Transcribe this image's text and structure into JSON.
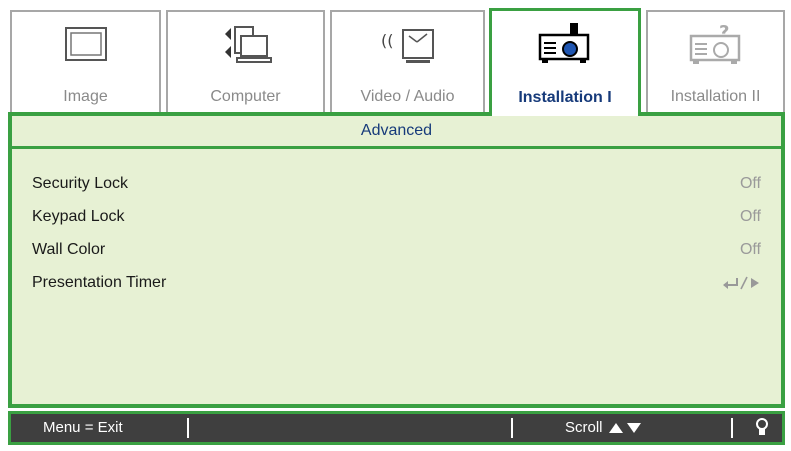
{
  "tabs": [
    {
      "label": "Image",
      "icon": "image-icon",
      "active": false
    },
    {
      "label": "Computer",
      "icon": "computer-icon",
      "active": false
    },
    {
      "label": "Video / Audio",
      "icon": "video-audio-icon",
      "active": false
    },
    {
      "label": "Installation I",
      "icon": "projector-icon",
      "active": true
    },
    {
      "label": "Installation II",
      "icon": "projector-question-icon",
      "active": false
    }
  ],
  "panel": {
    "title": "Advanced",
    "items": [
      {
        "name": "Security Lock",
        "value": "Off"
      },
      {
        "name": "Keypad Lock",
        "value": "Off"
      },
      {
        "name": "Wall Color",
        "value": "Off"
      },
      {
        "name": "Presentation Timer",
        "value": "",
        "value_icon": "enter-arrow-icon"
      }
    ]
  },
  "statusbar": {
    "menu_exit": "Menu = Exit",
    "scroll": "Scroll",
    "scroll_icon": "up-down-triangle-icon",
    "bulb_icon": "lamp-icon"
  },
  "colors": {
    "accent_green": "#3aa042",
    "panel_bg": "#e7f1d4",
    "active_text": "#163a7a",
    "status_bg": "#3f3f3f"
  }
}
